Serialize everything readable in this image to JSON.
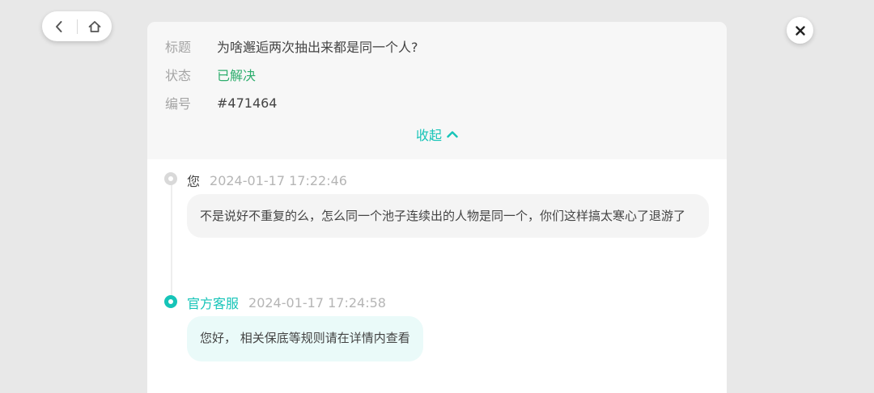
{
  "nav": {
    "back_icon": "chevron-left-icon",
    "home_icon": "home-icon",
    "close_icon": "close-icon"
  },
  "ticket": {
    "title_label": "标题",
    "title_value": "为啥邂逅两次抽出来都是同一个人?",
    "status_label": "状态",
    "status_value": "已解决",
    "id_label": "编号",
    "id_value": "#471464",
    "collapse_label": "收起"
  },
  "messages": [
    {
      "sender": "您",
      "time": "2024-01-17 17:22:46",
      "text": "不是说好不重复的么，怎么同一个池子连续出的人物是同一个，你们这样搞太寒心了退游了"
    },
    {
      "sender": "官方客服",
      "time": "2024-01-17 17:24:58",
      "text": "您好， 相关保底等规则请在详情内查看"
    }
  ],
  "colors": {
    "accent": "#16c4b8",
    "resolved": "#2fae6e",
    "background": "#e8e8e8"
  }
}
